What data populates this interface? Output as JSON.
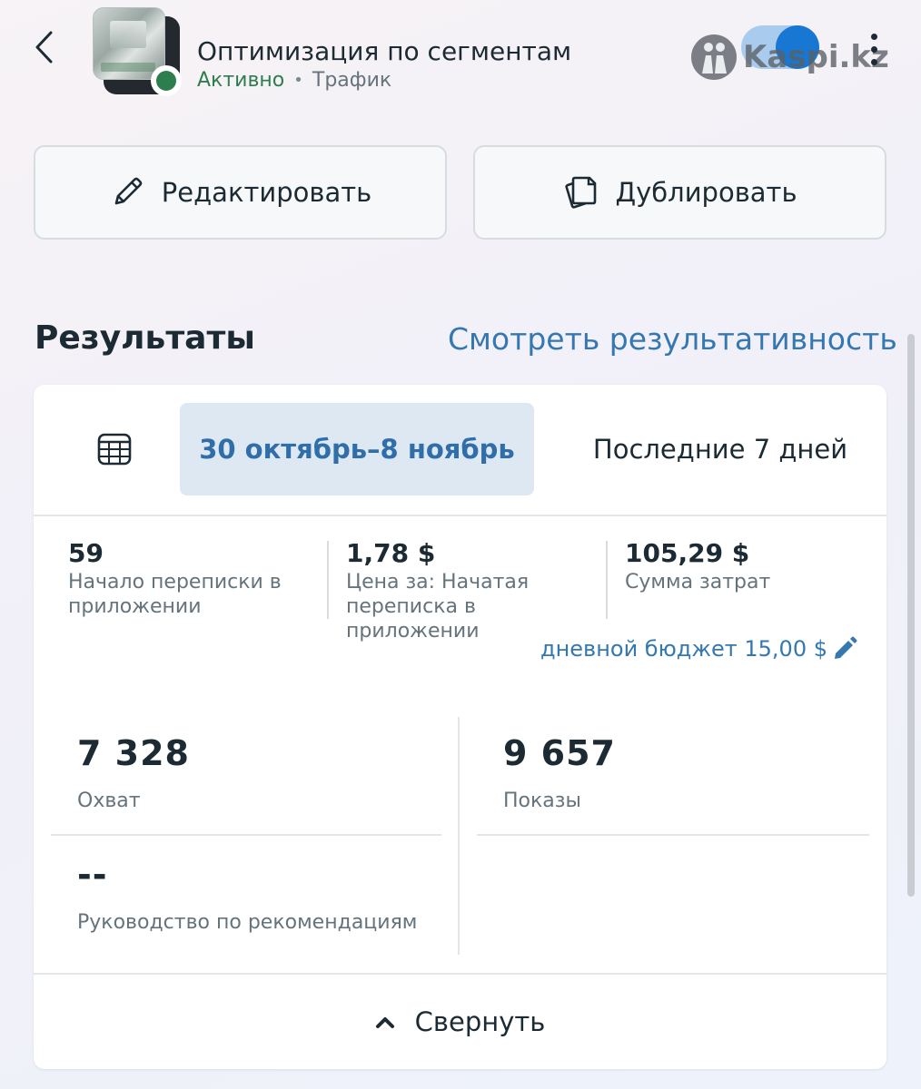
{
  "header": {
    "title": "Оптимизация по сегментам",
    "status": "Активно",
    "separator": "•",
    "objective": "Трафик",
    "toggle_on": true,
    "watermark": "Kaspi.kz"
  },
  "actions": {
    "edit_label": "Редактировать",
    "duplicate_label": "Дублировать"
  },
  "results": {
    "title": "Результаты",
    "view_link": "Смотреть результативность",
    "date_range": "30 октябрь–8 ноябрь",
    "preset": "Последние 7 дней",
    "kpis": [
      {
        "value": "59",
        "label": "Начало переписки в приложении"
      },
      {
        "value": "1,78 $",
        "label": "Цена за: Начатая переписка в приложении"
      },
      {
        "value": "105,29 $",
        "label": "Сумма затрат"
      }
    ],
    "daily_budget": "дневной бюджет 15,00 $",
    "metrics": {
      "reach": {
        "value": "7 328",
        "label": "Охват"
      },
      "impressions": {
        "value": "9 657",
        "label": "Показы"
      },
      "guidance": {
        "value": "--",
        "label": "Руководство по рекомендациям"
      }
    },
    "collapse_label": "Свернуть"
  },
  "colors": {
    "accent": "#1877d2",
    "link": "#3578b0",
    "active_green": "#2e7d4f",
    "chip_bg": "#dde8f3"
  }
}
